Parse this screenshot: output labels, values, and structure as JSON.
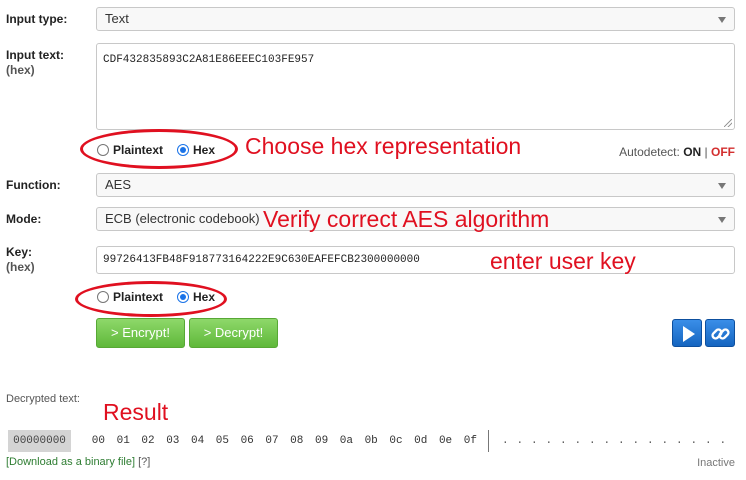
{
  "input": {
    "type_label": "Input type:",
    "type_value": "Text",
    "text_label": "Input text:",
    "text_sub": "(hex)",
    "text_value": "CDF432835893C2A81E86EEEC103FE957",
    "format_plaintext": "Plaintext",
    "format_hex": "Hex",
    "format_selected": "Hex"
  },
  "autodetect": {
    "label": "Autodetect:",
    "on": "ON",
    "sep": "|",
    "off": "OFF"
  },
  "function": {
    "label": "Function:",
    "value": "AES"
  },
  "mode": {
    "label": "Mode:",
    "value": "ECB (electronic codebook)"
  },
  "key": {
    "label": "Key:",
    "sub": "(hex)",
    "value": "99726413FB48F918773164222E9C630EAFEFCB2300000000",
    "format_plaintext": "Plaintext",
    "format_hex": "Hex",
    "format_selected": "Hex"
  },
  "buttons": {
    "encrypt": "> Encrypt!",
    "decrypt": "> Decrypt!"
  },
  "annotations": {
    "hex": "Choose hex representation",
    "aes": "Verify correct AES algorithm",
    "key": "enter user key",
    "result": "Result"
  },
  "output": {
    "label": "Decrypted text:",
    "offset": "00000000",
    "hex_header": [
      "00",
      "01",
      "02",
      "03",
      "04",
      "05",
      "06",
      "07",
      "08",
      "09",
      "0a",
      "0b",
      "0c",
      "0d",
      "0e",
      "0f"
    ],
    "ascii_placeholder": [
      ".",
      ".",
      ".",
      ".",
      ".",
      ".",
      ".",
      ".",
      ".",
      ".",
      ".",
      ".",
      ".",
      ".",
      ".",
      "."
    ],
    "download": "[Download as a binary file]",
    "help": "[?]",
    "status": "Inactive"
  },
  "colors": {
    "annotation": "#e01020",
    "button_green": "#6cc24a",
    "icon_blue": "#1976d2"
  },
  "icons": [
    "play-icon",
    "link-icon",
    "chevron-down-icon"
  ]
}
